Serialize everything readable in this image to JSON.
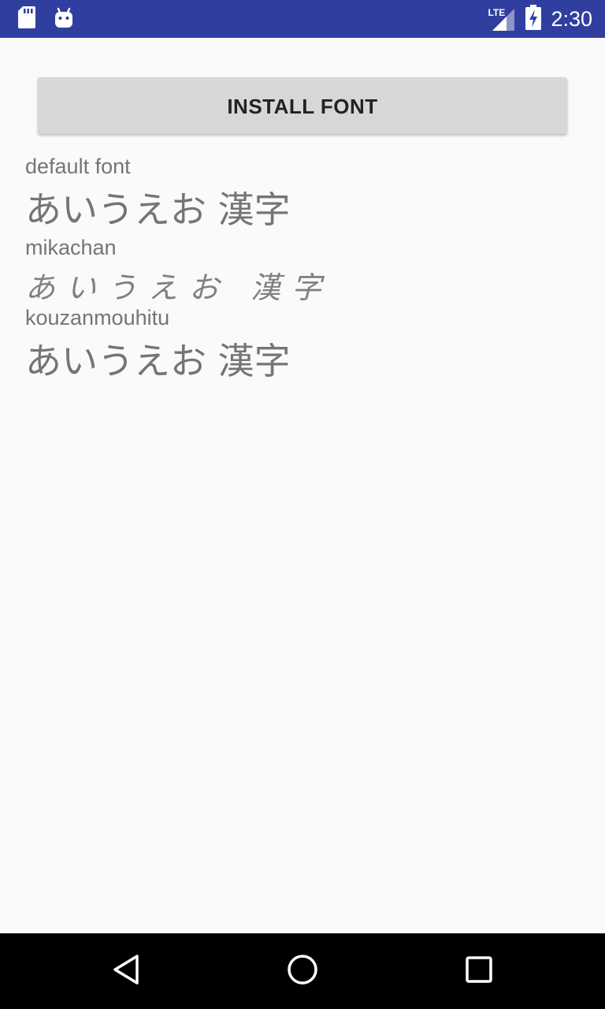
{
  "status_bar": {
    "time": "2:30",
    "network_label": "LTE",
    "icons": [
      "sd-card-icon",
      "android-icon",
      "lte-signal-icon",
      "battery-charging-icon"
    ],
    "background_color": "#303f9f"
  },
  "main": {
    "install_button_label": "INSTALL FONT",
    "fonts": [
      {
        "name": "default font",
        "sample": "あいうえお 漢字"
      },
      {
        "name": "mikachan",
        "sample": "あいうえお 漢字"
      },
      {
        "name": "kouzanmouhitu",
        "sample": "あいうえお 漢字"
      }
    ],
    "text_color": "#757575",
    "button_color": "#d6d7d7"
  },
  "nav_bar": {
    "icons": [
      "back-icon",
      "home-icon",
      "recents-icon"
    ]
  }
}
